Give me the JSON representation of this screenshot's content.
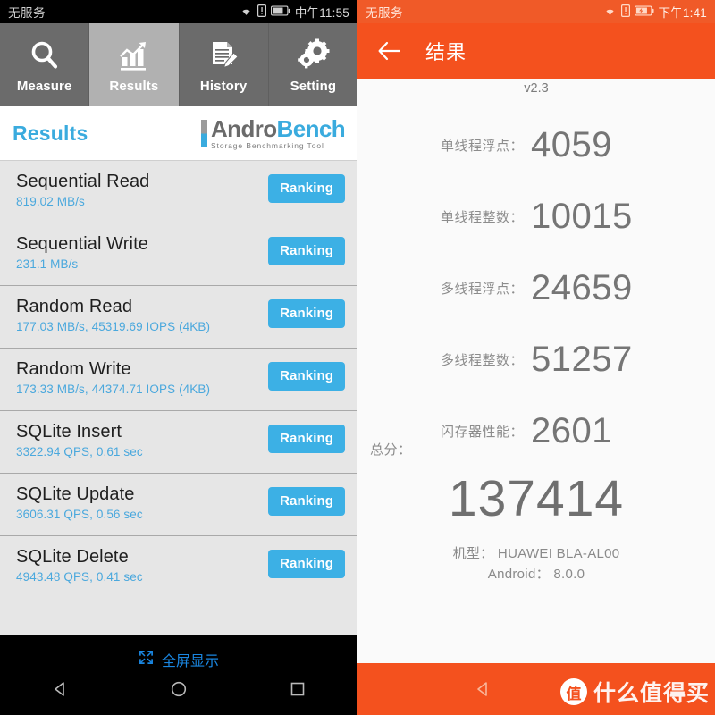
{
  "left": {
    "statusbar": {
      "carrier": "无服务",
      "time": "中午11:55",
      "icons": [
        "wifi-icon",
        "sim-alert-icon",
        "battery-icon"
      ]
    },
    "tabs": [
      {
        "label": "Measure",
        "icon": "magnifier-icon",
        "active": false
      },
      {
        "label": "Results",
        "icon": "bar-chart-trend-icon",
        "active": true
      },
      {
        "label": "History",
        "icon": "document-pencil-icon",
        "active": false
      },
      {
        "label": "Setting",
        "icon": "gears-icon",
        "active": false
      }
    ],
    "header": {
      "title": "Results",
      "brand_andro": "Andro",
      "brand_bench": "Bench",
      "brand_sub": "Storage Benchmarking Tool"
    },
    "results": [
      {
        "title": "Sequential Read",
        "value": "819.02 MB/s",
        "button": "Ranking"
      },
      {
        "title": "Sequential Write",
        "value": "231.1 MB/s",
        "button": "Ranking"
      },
      {
        "title": "Random Read",
        "value": "177.03 MB/s, 45319.69 IOPS (4KB)",
        "button": "Ranking"
      },
      {
        "title": "Random Write",
        "value": "173.33 MB/s, 44374.71 IOPS (4KB)",
        "button": "Ranking"
      },
      {
        "title": "SQLite Insert",
        "value": "3322.94 QPS, 0.61 sec",
        "button": "Ranking"
      },
      {
        "title": "SQLite Update",
        "value": "3606.31 QPS, 0.56 sec",
        "button": "Ranking"
      },
      {
        "title": "SQLite Delete",
        "value": "4943.48 QPS, 0.41 sec",
        "button": "Ranking"
      }
    ],
    "fullscreen_hint": "全屏显示",
    "navbar": [
      "back-icon",
      "home-icon",
      "recents-icon"
    ],
    "colors": {
      "accent": "#3cb0e5",
      "tab_active": "#b1b1b1",
      "tab_inactive": "#6b6b6b"
    }
  },
  "right": {
    "statusbar": {
      "carrier": "无服务",
      "time": "下午1:41",
      "icons": [
        "wifi-icon",
        "sim-alert-icon",
        "battery-charging-icon"
      ]
    },
    "appbar": {
      "back": "back-arrow-icon",
      "title": "结果"
    },
    "version": "v2.3",
    "scores": [
      {
        "label": "单线程浮点：",
        "value": "4059"
      },
      {
        "label": "单线程整数：",
        "value": "10015"
      },
      {
        "label": "多线程浮点：",
        "value": "24659"
      },
      {
        "label": "多线程整数：",
        "value": "51257"
      },
      {
        "label": "闪存器性能：",
        "value": "2601"
      }
    ],
    "total": {
      "label": "总分：",
      "value": "137414"
    },
    "device": {
      "model_line": "机型： HUAWEI BLA-AL00",
      "android_line": "Android： 8.0.0"
    },
    "navbar": [
      "back-icon",
      "home-icon"
    ],
    "watermark": {
      "badge": "值",
      "text": "什么值得买"
    },
    "colors": {
      "appbar": "#f4511e",
      "statusbar": "#f05a28",
      "background": "#fafafa"
    }
  }
}
